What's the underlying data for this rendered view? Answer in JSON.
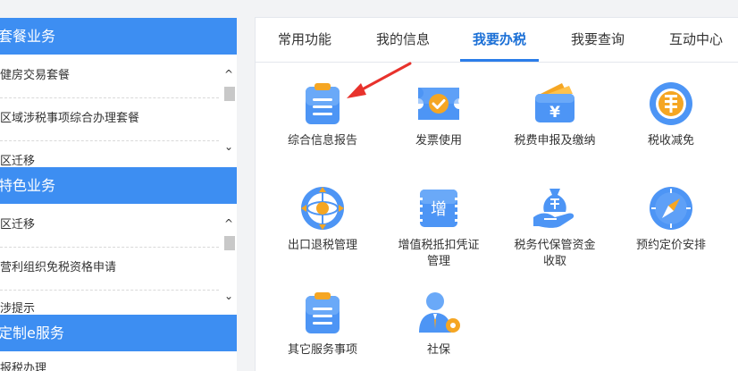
{
  "sections": [
    {
      "title": "套餐业务",
      "items": [
        "健房交易套餐",
        "区域涉税事项综合办理套餐",
        "区迁移"
      ]
    },
    {
      "title": "特色业务",
      "items": [
        "区迁移",
        "营利组织免税资格申请",
        "涉提示"
      ]
    },
    {
      "title": "定制e服务",
      "items": [
        "报税办理"
      ]
    }
  ],
  "scroll": {
    "up": "^",
    "down": "⌄"
  },
  "tabs": [
    {
      "label": "常用功能",
      "active": false
    },
    {
      "label": "我的信息",
      "active": false
    },
    {
      "label": "我要办税",
      "active": true
    },
    {
      "label": "我要查询",
      "active": false
    },
    {
      "label": "互动中心",
      "active": false
    }
  ],
  "services": [
    {
      "label": "综合信息报告",
      "icon": "clipboard-report-icon"
    },
    {
      "label": "发票使用",
      "icon": "ticket-check-icon"
    },
    {
      "label": "税费申报及缴纳",
      "icon": "wallet-yuan-icon"
    },
    {
      "label": "税收减免",
      "icon": "tax-reduction-coin-icon"
    },
    {
      "label": "出口退税管理",
      "icon": "globe-export-icon"
    },
    {
      "label": "增值税抵扣凭证管理",
      "line1": "增值税抵扣凭证",
      "line2": "管理",
      "icon": "vat-ticket-icon",
      "glyph": "增"
    },
    {
      "label": "税务代保管资金收取",
      "line1": "税务代保管资金",
      "line2": "收取",
      "icon": "money-bag-hand-icon"
    },
    {
      "label": "预约定价安排",
      "icon": "compass-icon"
    },
    {
      "label": "其它服务事项",
      "icon": "clipboard-list-icon"
    },
    {
      "label": "社保",
      "icon": "person-gear-icon"
    }
  ],
  "colors": {
    "header": "#3d8ef2",
    "active_tab": "#1a6fd6",
    "icon_blue": "#3a86f0",
    "icon_orange": "#f5a623",
    "pointer": "#e8322c"
  }
}
